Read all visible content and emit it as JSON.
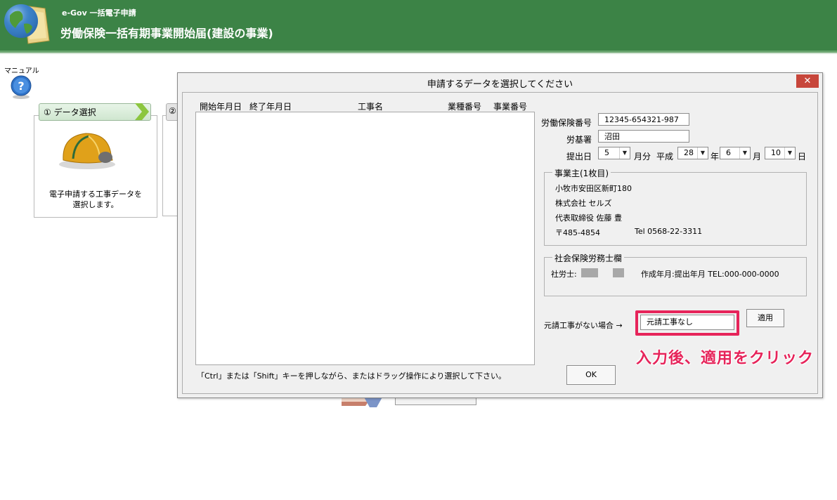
{
  "header": {
    "app_subtitle": "e-Gov 一括電子申請",
    "app_title": "労働保険一括有期事業開始届(建設の事業)"
  },
  "background": {
    "manual_label": "マニュアル",
    "step1_label": "① データ選択",
    "step1_desc_line1": "電子申請する工事データを",
    "step1_desc_line2": "選択します。",
    "step2_label": "②"
  },
  "dialog": {
    "title": "申請するデータを選択してください",
    "close_label": "✕",
    "columns": [
      "開始年月日",
      "終了年月日",
      "工事名",
      "業種番号",
      "事業番号"
    ],
    "rows": [],
    "hint": "「Ctrl」または「Shift」キーを押しながら、またはドラッグ操作により選択して下さい。",
    "ok_label": "OK"
  },
  "form": {
    "labor_insurance_number_label": "労働保険番号",
    "labor_insurance_number": "12345-654321-987",
    "office_label": "労基署",
    "office": "沼田",
    "submit_date_label": "提出日",
    "month_value": "5",
    "month_unit": "月分",
    "era_label": "平成",
    "year_value": "28",
    "year_unit": "年",
    "date_month_value": "6",
    "date_month_unit": "月",
    "day_value": "10",
    "day_unit": "日"
  },
  "employer": {
    "group_label": "事業主(1枚目)",
    "address": "小牧市安田区新町180",
    "company": "株式会社 セルズ",
    "representative": "代表取締役 佐藤 豊",
    "postal": "〒485-4854",
    "tel": "Tel 0568-22-3311"
  },
  "sharoushi": {
    "group_label": "社会保険労務士欄",
    "name_prefix": "社労士:",
    "created_info": "作成年月:提出年月 TEL:000-000-0000"
  },
  "prime_contract": {
    "label": "元請工事がない場合 →",
    "value": "元請工事なし",
    "apply_label": "適用"
  },
  "annotation": {
    "callout": "入力後、適用をクリック",
    "color": "#e6245a"
  }
}
